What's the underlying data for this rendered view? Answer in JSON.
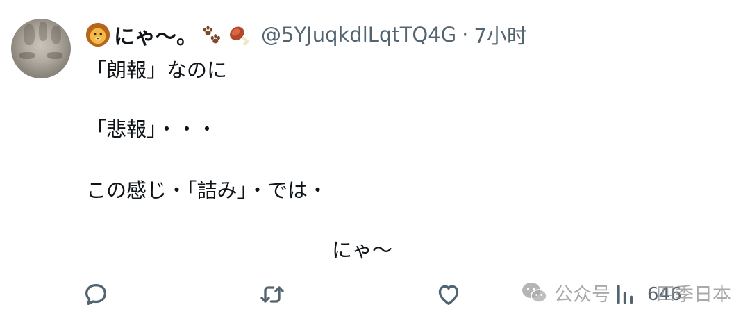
{
  "tweet": {
    "display_name": "にゃ〜。",
    "name_emoji_left": "lion-face-icon",
    "name_emoji_right": [
      "paw-prints-icon",
      "meat-on-bone-icon"
    ],
    "handle": "@5YJuqkdlLqtTQ4G",
    "separator": "·",
    "time": "7小时",
    "lines": [
      "「朗報」なのに",
      "「悲報」・・・",
      "この感じ・「詰み」・では・",
      "にゃ〜"
    ]
  },
  "actions": {
    "reply_icon": "reply-bubble-icon",
    "retweet_icon": "retweet-icon",
    "like_icon": "heart-icon",
    "views_icon": "views-bar-icon",
    "views_count": "646"
  },
  "watermark": {
    "icon": "wechat-icon",
    "left_text": "公众号",
    "right_text": "四季日本"
  }
}
